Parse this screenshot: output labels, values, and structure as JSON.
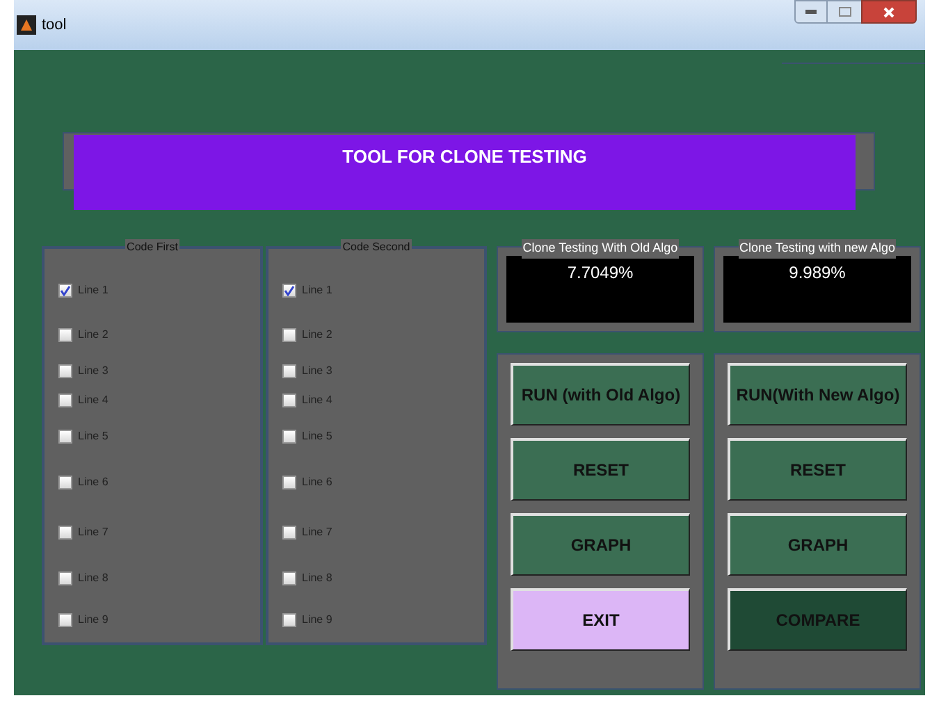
{
  "window": {
    "title": "tool"
  },
  "banner": {
    "title": "TOOL FOR CLONE TESTING"
  },
  "code_panels": [
    {
      "title": "Code First",
      "lines": [
        {
          "label": "Line 1",
          "checked": true
        },
        {
          "label": "Line 2",
          "checked": false
        },
        {
          "label": "Line 3",
          "checked": false
        },
        {
          "label": "Line 4",
          "checked": false
        },
        {
          "label": "Line 5",
          "checked": false
        },
        {
          "label": "Line 6",
          "checked": false
        },
        {
          "label": "Line 7",
          "checked": false
        },
        {
          "label": "Line 8",
          "checked": false
        },
        {
          "label": "Line 9",
          "checked": false
        }
      ]
    },
    {
      "title": "Code Second",
      "lines": [
        {
          "label": "Line 1",
          "checked": true
        },
        {
          "label": "Line 2",
          "checked": false
        },
        {
          "label": "Line 3",
          "checked": false
        },
        {
          "label": "Line 4",
          "checked": false
        },
        {
          "label": "Line 5",
          "checked": false
        },
        {
          "label": "Line 6",
          "checked": false
        },
        {
          "label": "Line 7",
          "checked": false
        },
        {
          "label": "Line 8",
          "checked": false
        },
        {
          "label": "Line 9",
          "checked": false
        }
      ]
    }
  ],
  "results": [
    {
      "title": "Clone Testing With Old Algo",
      "value": "7.7049%"
    },
    {
      "title": "Clone Testing with new Algo",
      "value": "9.989%"
    }
  ],
  "button_panels": [
    {
      "buttons": [
        {
          "label": "RUN (with Old Algo)",
          "color": "#3b6e53"
        },
        {
          "label": "RESET",
          "color": "#3b6e53"
        },
        {
          "label": "GRAPH",
          "color": "#3b6e53"
        },
        {
          "label": "EXIT",
          "color": "#dcb6f6"
        }
      ]
    },
    {
      "buttons": [
        {
          "label": "RUN(With New Algo)",
          "color": "#3b6e53"
        },
        {
          "label": "RESET",
          "color": "#3b6e53"
        },
        {
          "label": "GRAPH",
          "color": "#3b6e53"
        },
        {
          "label": "COMPARE",
          "color": "#1f4a35"
        }
      ]
    }
  ]
}
